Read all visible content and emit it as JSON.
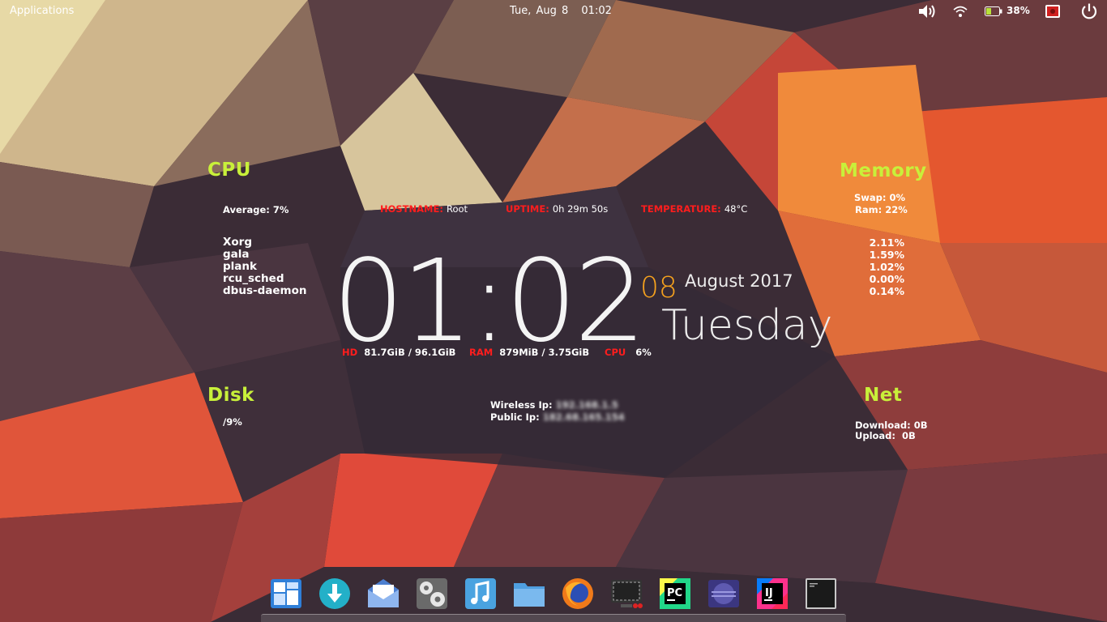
{
  "panel": {
    "applications_label": "Applications",
    "date": "Tue, Aug  8",
    "time": "01:02",
    "battery_percent": "38%",
    "icons": [
      "volume-icon",
      "wifi-icon",
      "battery-icon",
      "notification-icon",
      "power-icon"
    ]
  },
  "cpu": {
    "title": "CPU",
    "average_label": "Average:",
    "average_value": "7%",
    "processes": [
      "Xorg",
      "gala",
      "plank",
      "rcu_sched",
      "dbus-daemon"
    ]
  },
  "info": {
    "hostname_label": "HOSTNAME:",
    "hostname_value": "Root",
    "uptime_label": "UPTIME:",
    "uptime_value": "0h 29m 50s",
    "temperature_label": "TEMPERATURE:",
    "temperature_value": "48°C"
  },
  "memory": {
    "title": "Memory",
    "swap": "Swap: 0%",
    "ram": "Ram: 22%",
    "values": [
      "2.11%",
      "1.59%",
      "1.02%",
      "0.00%",
      "0.14%"
    ]
  },
  "clock": {
    "time": "01:02",
    "day_number": "08",
    "month_year": "August 2017",
    "weekday": "Tuesday"
  },
  "stats": {
    "hd_label": "HD",
    "hd_value": "81.7GiB / 96.1GiB",
    "ram_label": "RAM",
    "ram_value": "879MiB / 3.75GiB",
    "cpu_label": "CPU",
    "cpu_value": "6%"
  },
  "disk": {
    "title": "Disk",
    "usage": "/9%"
  },
  "network_ip": {
    "wireless_label": "Wireless Ip:",
    "wireless_value": "192.168.1.5",
    "public_label": "Public Ip:",
    "public_value": "182.68.165.154"
  },
  "net": {
    "title": "Net",
    "download": "Download: 0B",
    "upload": "Upload:  0B"
  },
  "dock": {
    "items": [
      "multitasking-view-icon",
      "appcenter-icon",
      "mail-icon",
      "settings-icon",
      "music-icon",
      "files-icon",
      "firefox-icon",
      "screenshot-icon",
      "pycharm-icon",
      "video-icon",
      "intellij-icon",
      "terminal-icon"
    ]
  },
  "colors": {
    "section_title": "#c8f03a",
    "label_red": "#ff1d1d",
    "day_accent": "#f6a21e"
  }
}
